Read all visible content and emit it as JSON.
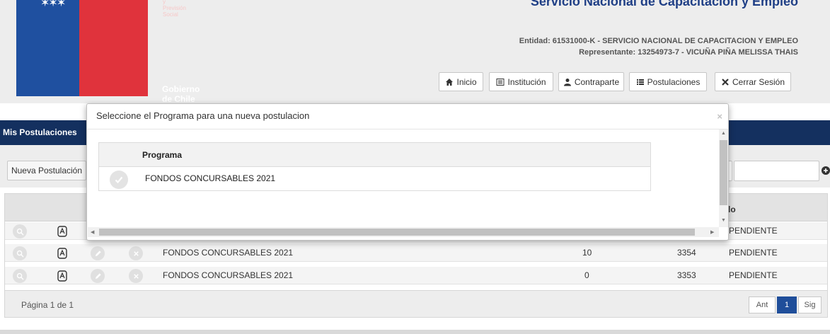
{
  "header": {
    "site_title": "Servicio Nacional de Capacitación y Empleo",
    "logo_text": "Gobierno de Chile",
    "entidad": "Entidad: 61531000-K - SERVICIO NACIONAL DE CAPACITACION Y EMPLEO",
    "representante": "Representante: 13254973-7 - VICUÑA PIÑA MELISSA THAIS",
    "nav": [
      {
        "label": "Inicio",
        "icon": "home-icon"
      },
      {
        "label": "Institución",
        "icon": "list-icon"
      },
      {
        "label": "Contraparte",
        "icon": "user-icon"
      },
      {
        "label": "Postulaciones",
        "icon": "list-bullets-icon"
      },
      {
        "label": "Cerrar Sesión",
        "icon": "close-icon"
      }
    ]
  },
  "section": {
    "title": "Mis Postulaciones",
    "new_button": "Nueva Postulación"
  },
  "grid": {
    "estado_header_partial": "do",
    "rows": [
      {
        "programa": "",
        "cantidad": "",
        "id": "",
        "estado": "PENDIENTE"
      },
      {
        "programa": "FONDOS CONCURSABLES 2021",
        "cantidad": "10",
        "id": "3354",
        "estado": "PENDIENTE"
      },
      {
        "programa": "FONDOS CONCURSABLES 2021",
        "cantidad": "0",
        "id": "3353",
        "estado": "PENDIENTE"
      }
    ],
    "pagination": {
      "text": "Página 1 de 1",
      "prev": "Ant",
      "current": "1",
      "next": "Sig"
    }
  },
  "modal": {
    "title": "Seleccione el Programa para una nueva postulacion",
    "close": "×",
    "column_header": "Programa",
    "programs": [
      "FONDOS CONCURSABLES 2021"
    ]
  },
  "colors": {
    "header_bg": "#ededed",
    "chile_blue": "#1f50a0",
    "chile_red": "#e0333c",
    "section_bar": "#14305f",
    "pagination_active": "#1f4e9a"
  }
}
